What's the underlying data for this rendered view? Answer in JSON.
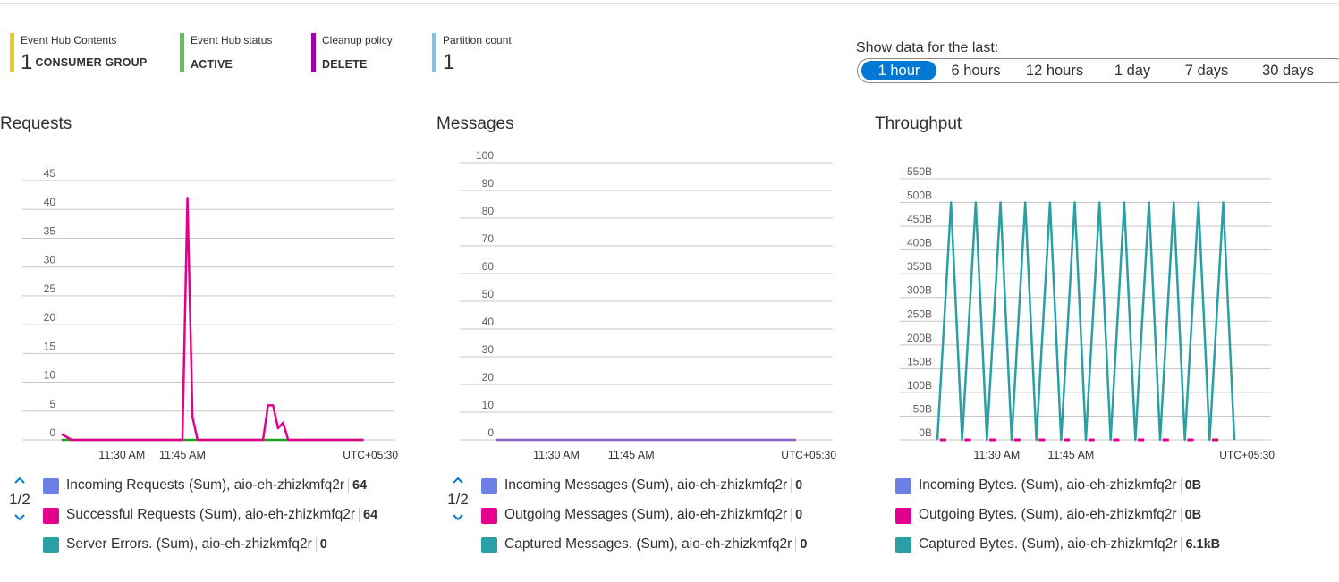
{
  "tiles": [
    {
      "label": "Event Hub Contents",
      "value": "1",
      "unit": "CONSUMER GROUP",
      "color": "#f2c811"
    },
    {
      "label": "Event Hub status",
      "value": "",
      "unit": "ACTIVE",
      "color": "#57c951"
    },
    {
      "label": "Cleanup policy",
      "value": "",
      "unit": "DELETE",
      "color": "#a200a8"
    },
    {
      "label": "Partition count",
      "value": "1",
      "unit": "",
      "color": "#7ec4e8"
    }
  ],
  "timeframe": {
    "title": "Show data for the last:",
    "options": [
      "1 hour",
      "6 hours",
      "12 hours",
      "1 day",
      "7 days",
      "30 days"
    ],
    "selected": "1 hour"
  },
  "charts": {
    "requests": {
      "title": "Requests",
      "timezone": "UTC+05:30",
      "page": "1/2",
      "legend": [
        {
          "label": "Incoming Requests (Sum), aio-eh-zhizkmfq2r",
          "value": "64",
          "color": "#6b7fe6"
        },
        {
          "label": "Successful Requests (Sum), aio-eh-zhizkmfq2r",
          "value": "64",
          "color": "#e3008c"
        },
        {
          "label": "Server Errors. (Sum), aio-eh-zhizkmfq2r",
          "value": "0",
          "color": "#2aa0a4"
        }
      ]
    },
    "messages": {
      "title": "Messages",
      "timezone": "UTC+05:30",
      "page": "1/2",
      "legend": [
        {
          "label": "Incoming Messages (Sum), aio-eh-zhizkmfq2r",
          "value": "0",
          "color": "#6b7fe6"
        },
        {
          "label": "Outgoing Messages (Sum), aio-eh-zhizkmfq2r",
          "value": "0",
          "color": "#e3008c"
        },
        {
          "label": "Captured Messages. (Sum), aio-eh-zhizkmfq2r",
          "value": "0",
          "color": "#2aa0a4"
        }
      ]
    },
    "throughput": {
      "title": "Throughput",
      "timezone": "UTC+05:30",
      "legend": [
        {
          "label": "Incoming Bytes. (Sum), aio-eh-zhizkmfq2r",
          "value": "0B",
          "color": "#6b7fe6"
        },
        {
          "label": "Outgoing Bytes. (Sum), aio-eh-zhizkmfq2r",
          "value": "0B",
          "color": "#e3008c"
        },
        {
          "label": "Captured Bytes. (Sum), aio-eh-zhizkmfq2r",
          "value": "6.1kB",
          "color": "#2aa0a4"
        }
      ]
    }
  },
  "chart_data": [
    {
      "type": "line",
      "title": "Requests",
      "x_ticks": [
        "11:30 AM",
        "11:45 AM"
      ],
      "x_minutes": [
        0,
        2,
        23,
        24,
        25,
        26,
        27,
        29,
        30,
        31,
        40,
        41,
        42,
        43,
        44,
        45,
        46,
        60
      ],
      "x_tick_minutes": [
        12,
        24
      ],
      "x_domain": [
        -0.5,
        59
      ],
      "ylim": [
        0,
        45
      ],
      "y_ticks": [
        0,
        5,
        10,
        15,
        20,
        25,
        30,
        35,
        40,
        45
      ],
      "series": [
        {
          "name": "Successful Requests (Sum), aio-eh-zhizkmfq2r",
          "color": "#e3008c",
          "values": [
            1,
            0,
            0,
            0,
            42,
            4,
            0,
            0,
            0,
            0,
            0,
            6,
            6,
            2,
            3,
            0,
            0,
            0
          ]
        },
        {
          "name": "Server Errors. (Sum), aio-eh-zhizkmfq2r",
          "color": "#22a022",
          "values": [
            0,
            0,
            0,
            0,
            0,
            0,
            0,
            0,
            0,
            0,
            0,
            0,
            0,
            0,
            0,
            0,
            0,
            0
          ]
        }
      ]
    },
    {
      "type": "line",
      "title": "Messages",
      "x_ticks": [
        "11:30 AM",
        "11:45 AM"
      ],
      "x_minutes": [
        0,
        60
      ],
      "x_tick_minutes": [
        12,
        27
      ],
      "x_domain": [
        0,
        60
      ],
      "ylim": [
        0,
        100
      ],
      "y_ticks": [
        0,
        10,
        20,
        30,
        40,
        50,
        60,
        70,
        80,
        90,
        100
      ],
      "series": [
        {
          "name": "Captured Messages. (Sum), aio-eh-zhizkmfq2r",
          "color": "#8661c5",
          "values": [
            0,
            0
          ]
        }
      ]
    },
    {
      "type": "line",
      "title": "Throughput",
      "x_ticks": [
        "11:30 AM",
        "11:45 AM"
      ],
      "x_minutes": [
        0,
        60
      ],
      "x_tick_minutes": [
        12,
        27
      ],
      "x_domain": [
        0,
        60
      ],
      "ylim": [
        0,
        550
      ],
      "y_ticks": [
        "0B",
        "50B",
        "100B",
        "150B",
        "200B",
        "250B",
        "300B",
        "350B",
        "400B",
        "450B",
        "500B",
        "550B"
      ],
      "spike_value": 500,
      "spike_count": 12,
      "series": [
        {
          "name": "Captured Bytes. (Sum), aio-eh-zhizkmfq2r",
          "color": "#2aa0a4"
        },
        {
          "name": "Outgoing Bytes. (Sum), aio-eh-zhizkmfq2r",
          "color": "#e3008c"
        }
      ]
    }
  ]
}
